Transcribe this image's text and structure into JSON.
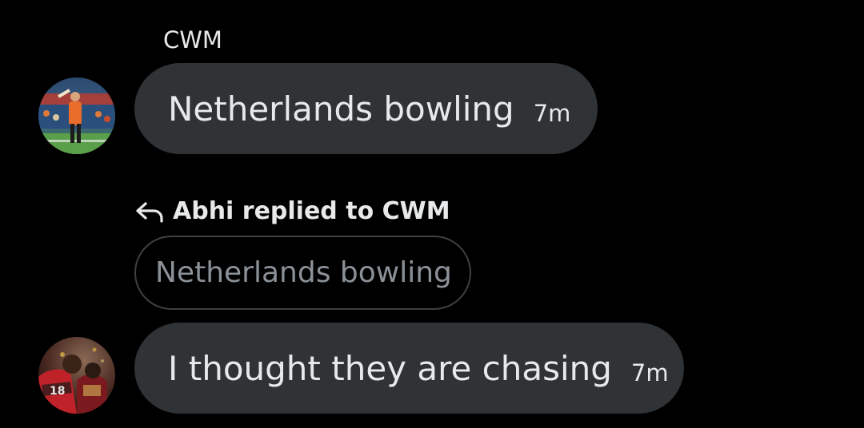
{
  "colors": {
    "background": "#000000",
    "bubble": "#2f3336",
    "text_primary": "#e7e9ea",
    "text_muted": "#8b9198",
    "quote_border": "#3e4144"
  },
  "messages": [
    {
      "sender": "CWM",
      "avatar_icon": "avatar-photo",
      "text": "Netherlands bowling",
      "time": "7m"
    },
    {
      "reply_icon": "reply-arrow-icon",
      "reply_label": "Abhi replied to CWM",
      "quoted_text": "Netherlands bowling",
      "avatar_icon": "avatar-photo",
      "text": "I thought they are chasing",
      "time": "7m"
    }
  ]
}
